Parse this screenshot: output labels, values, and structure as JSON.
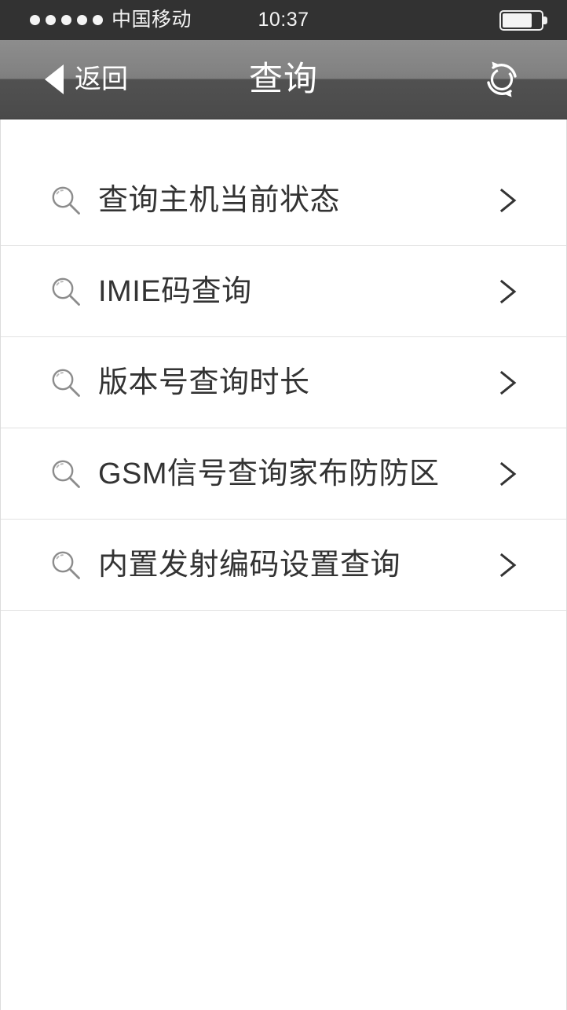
{
  "status_bar": {
    "carrier": "中国移动",
    "signal_dots_total": 5,
    "signal_dots_filled": 5,
    "time": "10:37",
    "battery_percent": 78,
    "background_color": "#323232",
    "text_color": "#f4f4f4"
  },
  "nav_bar": {
    "back_label": "返回",
    "title": "查询",
    "refresh_icon": "refresh-sync-icon",
    "back_icon": "triangle-left-icon",
    "gradient_top_color": "#8d8d8d",
    "gradient_bottom_color": "#4a4a4a",
    "text_color": "#ffffff"
  },
  "list": {
    "row_icon": "magnifier-icon",
    "row_accessory_icon": "chevron-right-icon",
    "separator_color": "#e2e2e2",
    "label_color": "#333333",
    "items": [
      {
        "label": "查询主机当前状态"
      },
      {
        "label": "IMIE码查询"
      },
      {
        "label": "版本号查询时长"
      },
      {
        "label": "GSM信号查询家布防防区"
      },
      {
        "label": "内置发射编码设置查询"
      }
    ]
  }
}
